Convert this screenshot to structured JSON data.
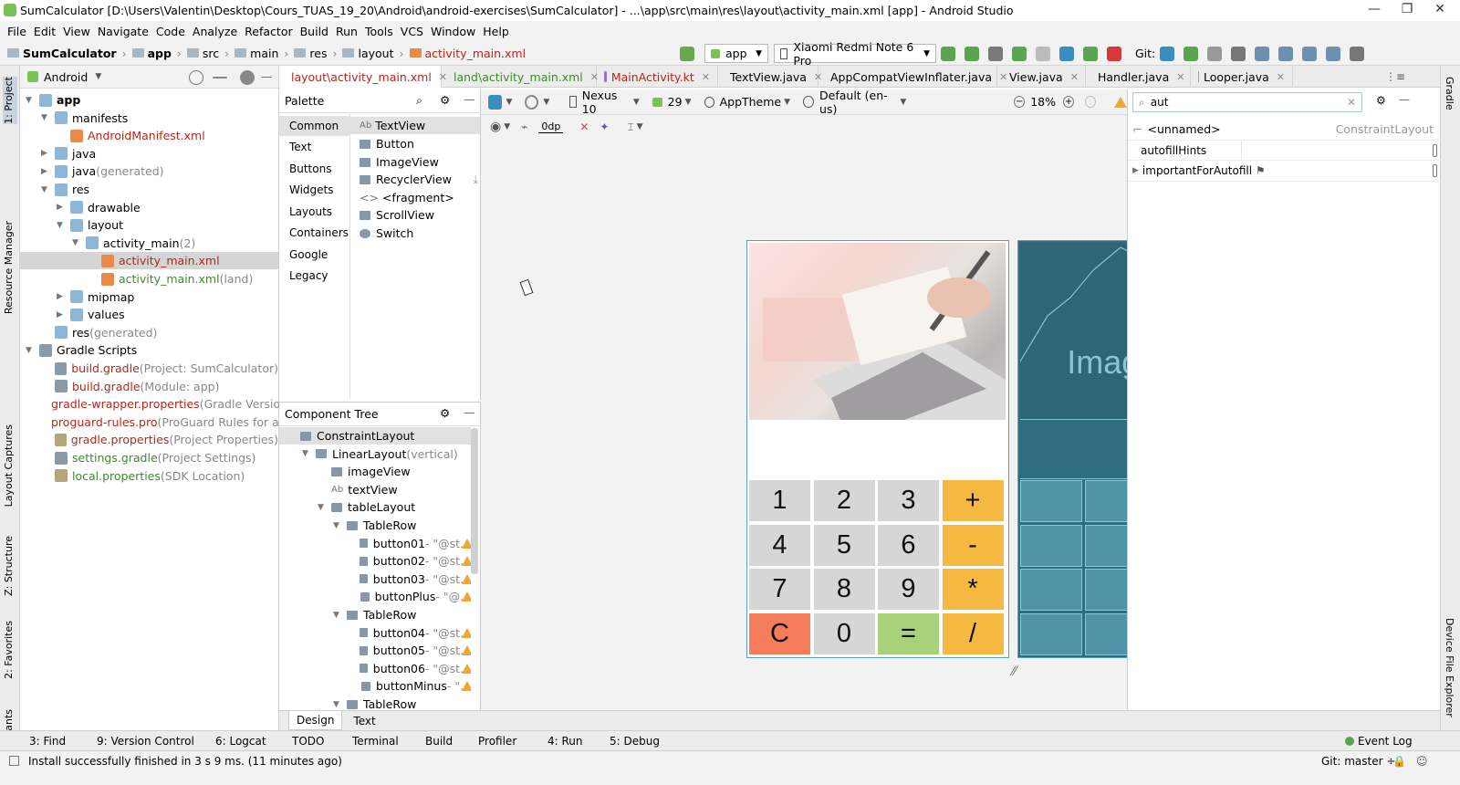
{
  "title_bar": {
    "text": "SumCalculator [D:\\Users\\Valentin\\Desktop\\Cours_TUAS_19_20\\Android\\android-exercises\\SumCalculator] - ...\\app\\src\\main\\res\\layout\\activity_main.xml [app] - Android Studio",
    "minimize": "—",
    "maximize": "❐",
    "close": "✕"
  },
  "menu": [
    "File",
    "Edit",
    "View",
    "Navigate",
    "Code",
    "Analyze",
    "Refactor",
    "Build",
    "Run",
    "Tools",
    "VCS",
    "Window",
    "Help"
  ],
  "nav": {
    "crumbs": [
      "SumCalculator",
      "app",
      "src",
      "main",
      "res",
      "layout",
      "activity_main.xml"
    ],
    "run_config": "app",
    "device": "Xiaomi Redmi Note 6 Pro",
    "git_label": "Git:"
  },
  "left_strip": [
    "1: Project",
    "Resource Manager",
    "Layout Captures",
    "Z: Structure",
    "2: Favorites",
    "Build Variants"
  ],
  "right_strip": [
    "Gradle",
    "Device File Explorer"
  ],
  "project": {
    "view": "Android",
    "tree": [
      {
        "label": "app",
        "depth": 0,
        "arrow": "▼",
        "kind": "folder",
        "bold": true
      },
      {
        "label": "manifests",
        "depth": 1,
        "arrow": "▼",
        "kind": "folder"
      },
      {
        "label": "AndroidManifest.xml",
        "depth": 2,
        "arrow": "",
        "kind": "file",
        "color": "#b2281d"
      },
      {
        "label": "java",
        "depth": 1,
        "arrow": "▶",
        "kind": "folder"
      },
      {
        "label": "java",
        "suffix": " (generated)",
        "depth": 1,
        "arrow": "▶",
        "kind": "folder"
      },
      {
        "label": "res",
        "depth": 1,
        "arrow": "▼",
        "kind": "folder"
      },
      {
        "label": "drawable",
        "depth": 2,
        "arrow": "▶",
        "kind": "folder"
      },
      {
        "label": "layout",
        "depth": 2,
        "arrow": "▼",
        "kind": "folder"
      },
      {
        "label": "activity_main",
        "suffix": " (2)",
        "depth": 3,
        "arrow": "▼",
        "kind": "folder"
      },
      {
        "label": "activity_main.xml",
        "depth": 4,
        "arrow": "",
        "kind": "xml",
        "color": "#b2281d",
        "selected": true
      },
      {
        "label": "activity_main.xml",
        "suffix": " (land)",
        "depth": 4,
        "arrow": "",
        "kind": "xml",
        "color": "#3d8a2a"
      },
      {
        "label": "mipmap",
        "depth": 2,
        "arrow": "▶",
        "kind": "folder"
      },
      {
        "label": "values",
        "depth": 2,
        "arrow": "▶",
        "kind": "folder"
      },
      {
        "label": "res",
        "suffix": " (generated)",
        "depth": 1,
        "arrow": "",
        "kind": "folder"
      },
      {
        "label": "Gradle Scripts",
        "depth": 0,
        "arrow": "▼",
        "kind": "gradle"
      },
      {
        "label": "build.gradle",
        "suffix": " (Project: SumCalculator)",
        "depth": 1,
        "arrow": "",
        "kind": "gradle",
        "color": "#b2281d"
      },
      {
        "label": "build.gradle",
        "suffix": " (Module: app)",
        "depth": 1,
        "arrow": "",
        "kind": "gradle",
        "color": "#b2281d"
      },
      {
        "label": "gradle-wrapper.properties",
        "suffix": " (Gradle Version)",
        "depth": 1,
        "arrow": "",
        "kind": "props",
        "color": "#b2281d"
      },
      {
        "label": "proguard-rules.pro",
        "suffix": " (ProGuard Rules for app)",
        "depth": 1,
        "arrow": "",
        "kind": "props",
        "color": "#b2281d"
      },
      {
        "label": "gradle.properties",
        "suffix": " (Project Properties)",
        "depth": 1,
        "arrow": "",
        "kind": "props",
        "color": "#b2281d"
      },
      {
        "label": "settings.gradle",
        "suffix": " (Project Settings)",
        "depth": 1,
        "arrow": "",
        "kind": "gradle",
        "color": "#3d8a2a"
      },
      {
        "label": "local.properties",
        "suffix": " (SDK Location)",
        "depth": 1,
        "arrow": "",
        "kind": "props",
        "color": "#3d8a2a"
      }
    ]
  },
  "tabs": [
    {
      "label": "layout\\activity_main.xml",
      "active": true
    },
    {
      "label": "land\\activity_main.xml",
      "color": "#3d8a2a"
    },
    {
      "label": "MainActivity.kt",
      "color": "#b2281d"
    },
    {
      "label": "TextView.java"
    },
    {
      "label": "AppCompatViewInflater.java"
    },
    {
      "label": "View.java"
    },
    {
      "label": "Handler.java"
    },
    {
      "label": "Looper.java"
    }
  ],
  "palette": {
    "title": "Palette",
    "categories": [
      "Common",
      "Text",
      "Buttons",
      "Widgets",
      "Layouts",
      "Containers",
      "Google",
      "Legacy"
    ],
    "items": [
      "TextView",
      "Button",
      "ImageView",
      "RecyclerView",
      "<fragment>",
      "ScrollView",
      "Switch"
    ],
    "item_prefix": "Ab"
  },
  "design_toolbar": {
    "device": "Nexus 10",
    "api": "29",
    "theme": "AppTheme",
    "locale": "Default (en-us)",
    "zoom": "18%",
    "margin": "0dp"
  },
  "component_tree": {
    "title": "Component Tree",
    "rows": [
      {
        "label": "ConstraintLayout",
        "depth": 0
      },
      {
        "label": "LinearLayout",
        "suffix": "(vertical)",
        "depth": 1,
        "arrow": "▼"
      },
      {
        "label": "imageView",
        "depth": 2
      },
      {
        "label": "textView",
        "depth": 2,
        "prefix": "Ab"
      },
      {
        "label": "tableLayout",
        "depth": 2,
        "arrow": "▼"
      },
      {
        "label": "TableRow",
        "depth": 3,
        "arrow": "▼"
      },
      {
        "label": "button01",
        "suffix": "- \"@st...",
        "depth": 4,
        "warn": true
      },
      {
        "label": "button02",
        "suffix": "- \"@st...",
        "depth": 4,
        "warn": true
      },
      {
        "label": "button03",
        "suffix": "- \"@st...",
        "depth": 4,
        "warn": true
      },
      {
        "label": "buttonPlus",
        "suffix": "- \"@...",
        "depth": 4,
        "warn": true
      },
      {
        "label": "TableRow",
        "depth": 3,
        "arrow": "▼"
      },
      {
        "label": "button04",
        "suffix": "- \"@st...",
        "depth": 4,
        "warn": true
      },
      {
        "label": "button05",
        "suffix": "- \"@st...",
        "depth": 4,
        "warn": true
      },
      {
        "label": "button06",
        "suffix": "- \"@st...",
        "depth": 4,
        "warn": true
      },
      {
        "label": "buttonMinus",
        "suffix": "- \"...",
        "depth": 4,
        "warn": true
      },
      {
        "label": "TableRow",
        "depth": 3,
        "arrow": "▼"
      }
    ]
  },
  "calculator": {
    "keys": [
      {
        "label": "1",
        "color": "#d6d6d6"
      },
      {
        "label": "2",
        "color": "#d6d6d6"
      },
      {
        "label": "3",
        "color": "#d6d6d6"
      },
      {
        "label": "+",
        "color": "#f5b942"
      },
      {
        "label": "4",
        "color": "#d6d6d6"
      },
      {
        "label": "5",
        "color": "#d6d6d6"
      },
      {
        "label": "6",
        "color": "#d6d6d6"
      },
      {
        "label": "-",
        "color": "#f5b942"
      },
      {
        "label": "7",
        "color": "#d6d6d6"
      },
      {
        "label": "8",
        "color": "#d6d6d6"
      },
      {
        "label": "9",
        "color": "#d6d6d6"
      },
      {
        "label": "*",
        "color": "#f5b942"
      },
      {
        "label": "C",
        "color": "#f47c5a"
      },
      {
        "label": "0",
        "color": "#d6d6d6"
      },
      {
        "label": "=",
        "color": "#a8d17a"
      },
      {
        "label": "/",
        "color": "#f5b942"
      }
    ]
  },
  "blueprint": {
    "image_label": "ImageView"
  },
  "attributes": {
    "search_value": "aut",
    "component": "<unnamed>",
    "component_type": "ConstraintLayout",
    "rows": [
      "autofillHints",
      "importantForAutofill"
    ]
  },
  "bottom_tabs": [
    "Design",
    "Text"
  ],
  "tool_windows": [
    "3: Find",
    "9: Version Control",
    "6: Logcat",
    "TODO",
    "Terminal",
    "Build",
    "Profiler",
    "4: Run",
    "5: Debug"
  ],
  "event_log": "Event Log",
  "status": {
    "message": "Install successfully finished in 3 s 9 ms. (11 minutes ago)",
    "git": "Git: master ÷"
  }
}
